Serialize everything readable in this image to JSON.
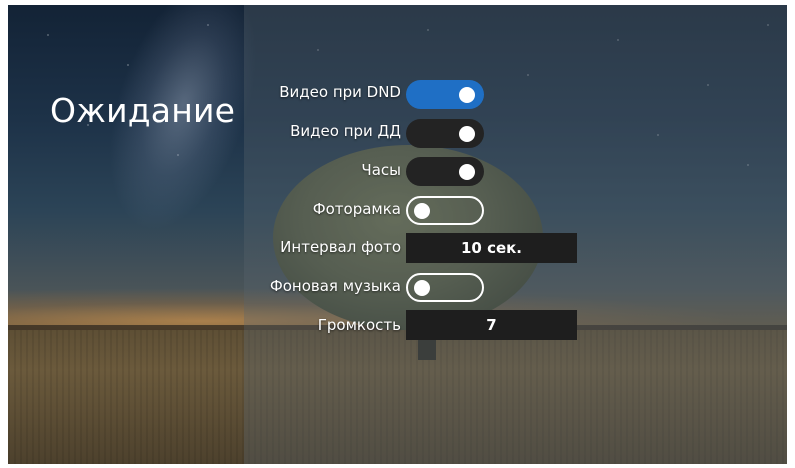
{
  "screen": {
    "title": "Ожидание"
  },
  "settings": [
    {
      "label": "Видео при DND",
      "type": "toggle",
      "state": "on",
      "style": "blue"
    },
    {
      "label": "Видео при ДД",
      "type": "toggle",
      "state": "on",
      "style": "dark"
    },
    {
      "label": "Часы",
      "type": "toggle",
      "state": "on",
      "style": "dark"
    },
    {
      "label": "Фоторамка",
      "type": "toggle",
      "state": "off",
      "style": "outline"
    },
    {
      "label": "Интервал фото",
      "type": "value",
      "value": "10 сек."
    },
    {
      "label": "Фоновая музыка",
      "type": "toggle",
      "state": "off",
      "style": "outline"
    },
    {
      "label": "Громкость",
      "type": "value",
      "value": "7"
    }
  ],
  "colors": {
    "accent": "#1f6fc5",
    "toggle_dark": "#232323",
    "value_box": "#1e1e1e",
    "text": "#ffffff"
  }
}
